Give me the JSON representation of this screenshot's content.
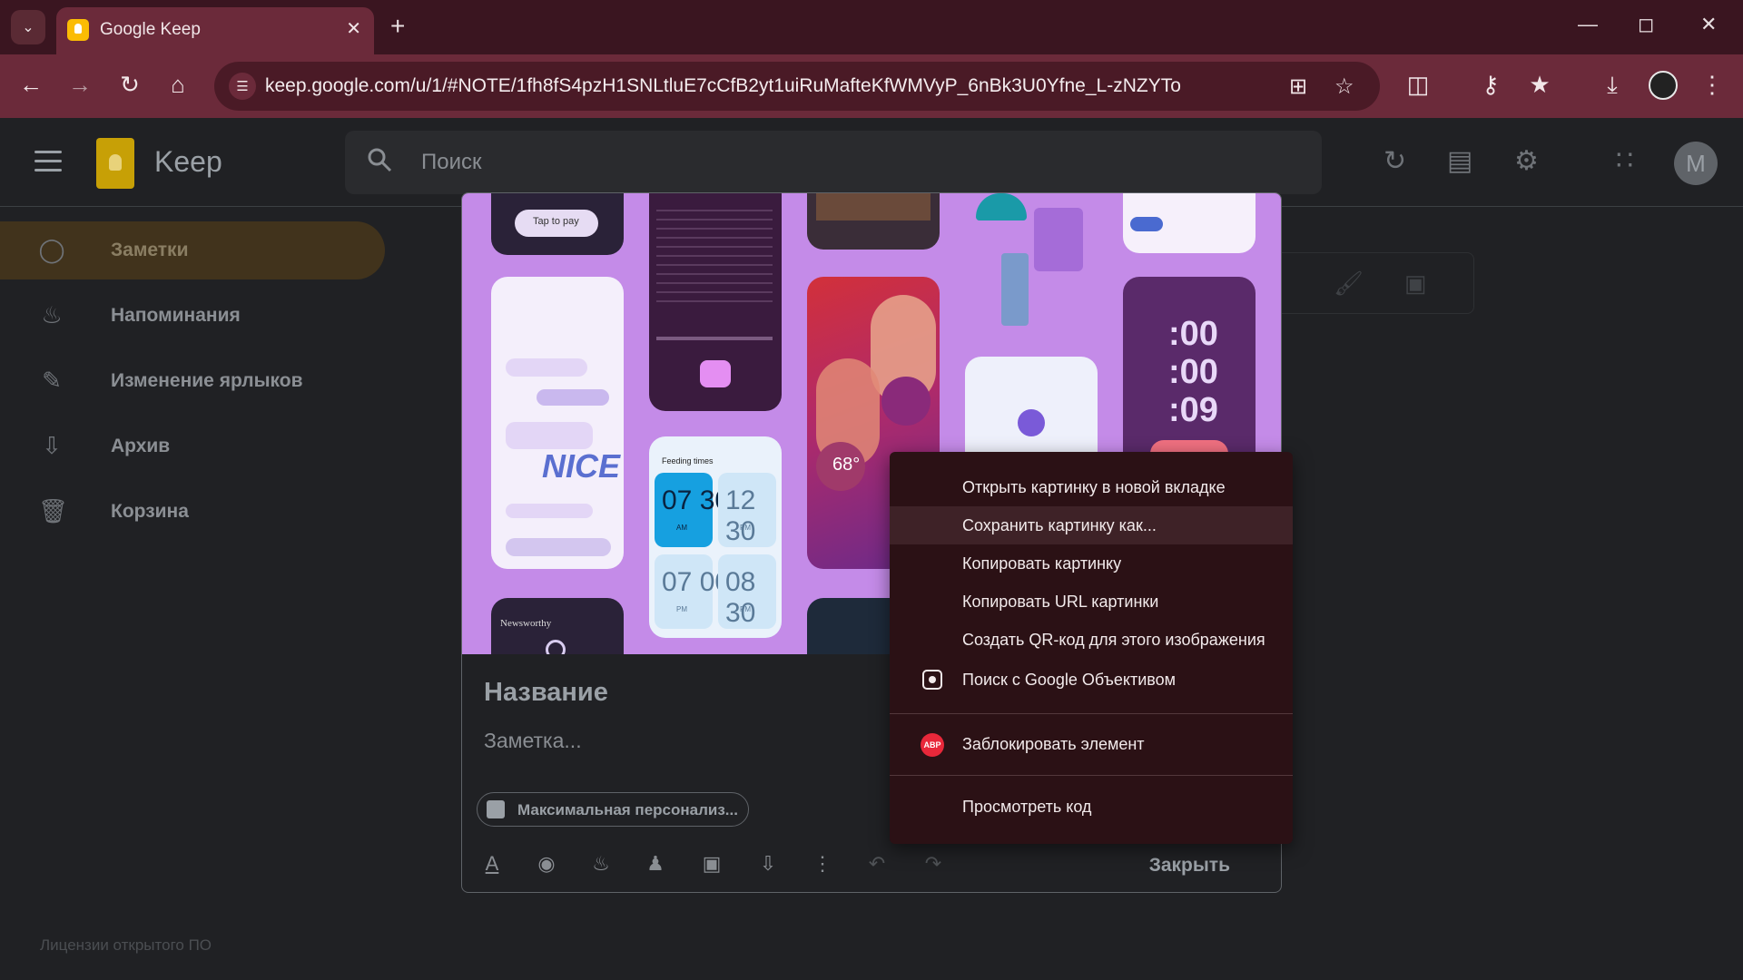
{
  "browser": {
    "tab_title": "Google Keep",
    "url": "keep.google.com/u/1/#NOTE/1fh8fS4pzH1SNLtluE7cCfB2yt1uiRuMafteKfWMVyP_6nBk3U0Yfne_L-zNZYTo"
  },
  "keep": {
    "app_name": "Keep",
    "search_placeholder": "Поиск",
    "account_initial": "M"
  },
  "sidebar": {
    "items": [
      {
        "label": "Заметки",
        "icon": "lightbulb-icon",
        "active": true
      },
      {
        "label": "Напоминания",
        "icon": "bell-icon",
        "active": false
      },
      {
        "label": "Изменение ярлыков",
        "icon": "pencil-icon",
        "active": false
      },
      {
        "label": "Архив",
        "icon": "archive-icon",
        "active": false
      },
      {
        "label": "Корзина",
        "icon": "trash-icon",
        "active": false
      }
    ],
    "oss_link": "Лицензии открытого ПО"
  },
  "note": {
    "title": "Название",
    "body": "Заметка...",
    "chip_label": "Максимальная персонализ...",
    "close_label": "Закрыть",
    "image_text": {
      "tap_to_pay": "Tap to pay",
      "nice": "NICE",
      "feeding_times": "Feeding times",
      "time1": "07 30",
      "time1_sub": "AM",
      "time2": "12 30",
      "time2_sub": "PM",
      "time3": "07 00",
      "time3_sub": "PM",
      "time4": "08 30",
      "time4_sub": "PM",
      "clock1": ":00",
      "clock2": ":00",
      "clock3": ":09",
      "temp": "68°",
      "newsworthy": "Newsworthy"
    }
  },
  "context_menu": {
    "items": [
      "Открыть картинку в новой вкладке",
      "Сохранить картинку как...",
      "Копировать картинку",
      "Копировать URL картинки",
      "Создать QR-код для этого изображения",
      "Поиск с Google Объективом",
      "Заблокировать элемент",
      "Просмотреть код"
    ],
    "hovered_index": 1,
    "abp_badge": "ABP"
  },
  "colors": {
    "tab_strip": "#3a1520",
    "toolbar": "#6b2a3a",
    "page_bg": "#202124",
    "menu_bg": "#2b1115",
    "image_bg": "#c48be8",
    "active_nav": "#41331c"
  }
}
